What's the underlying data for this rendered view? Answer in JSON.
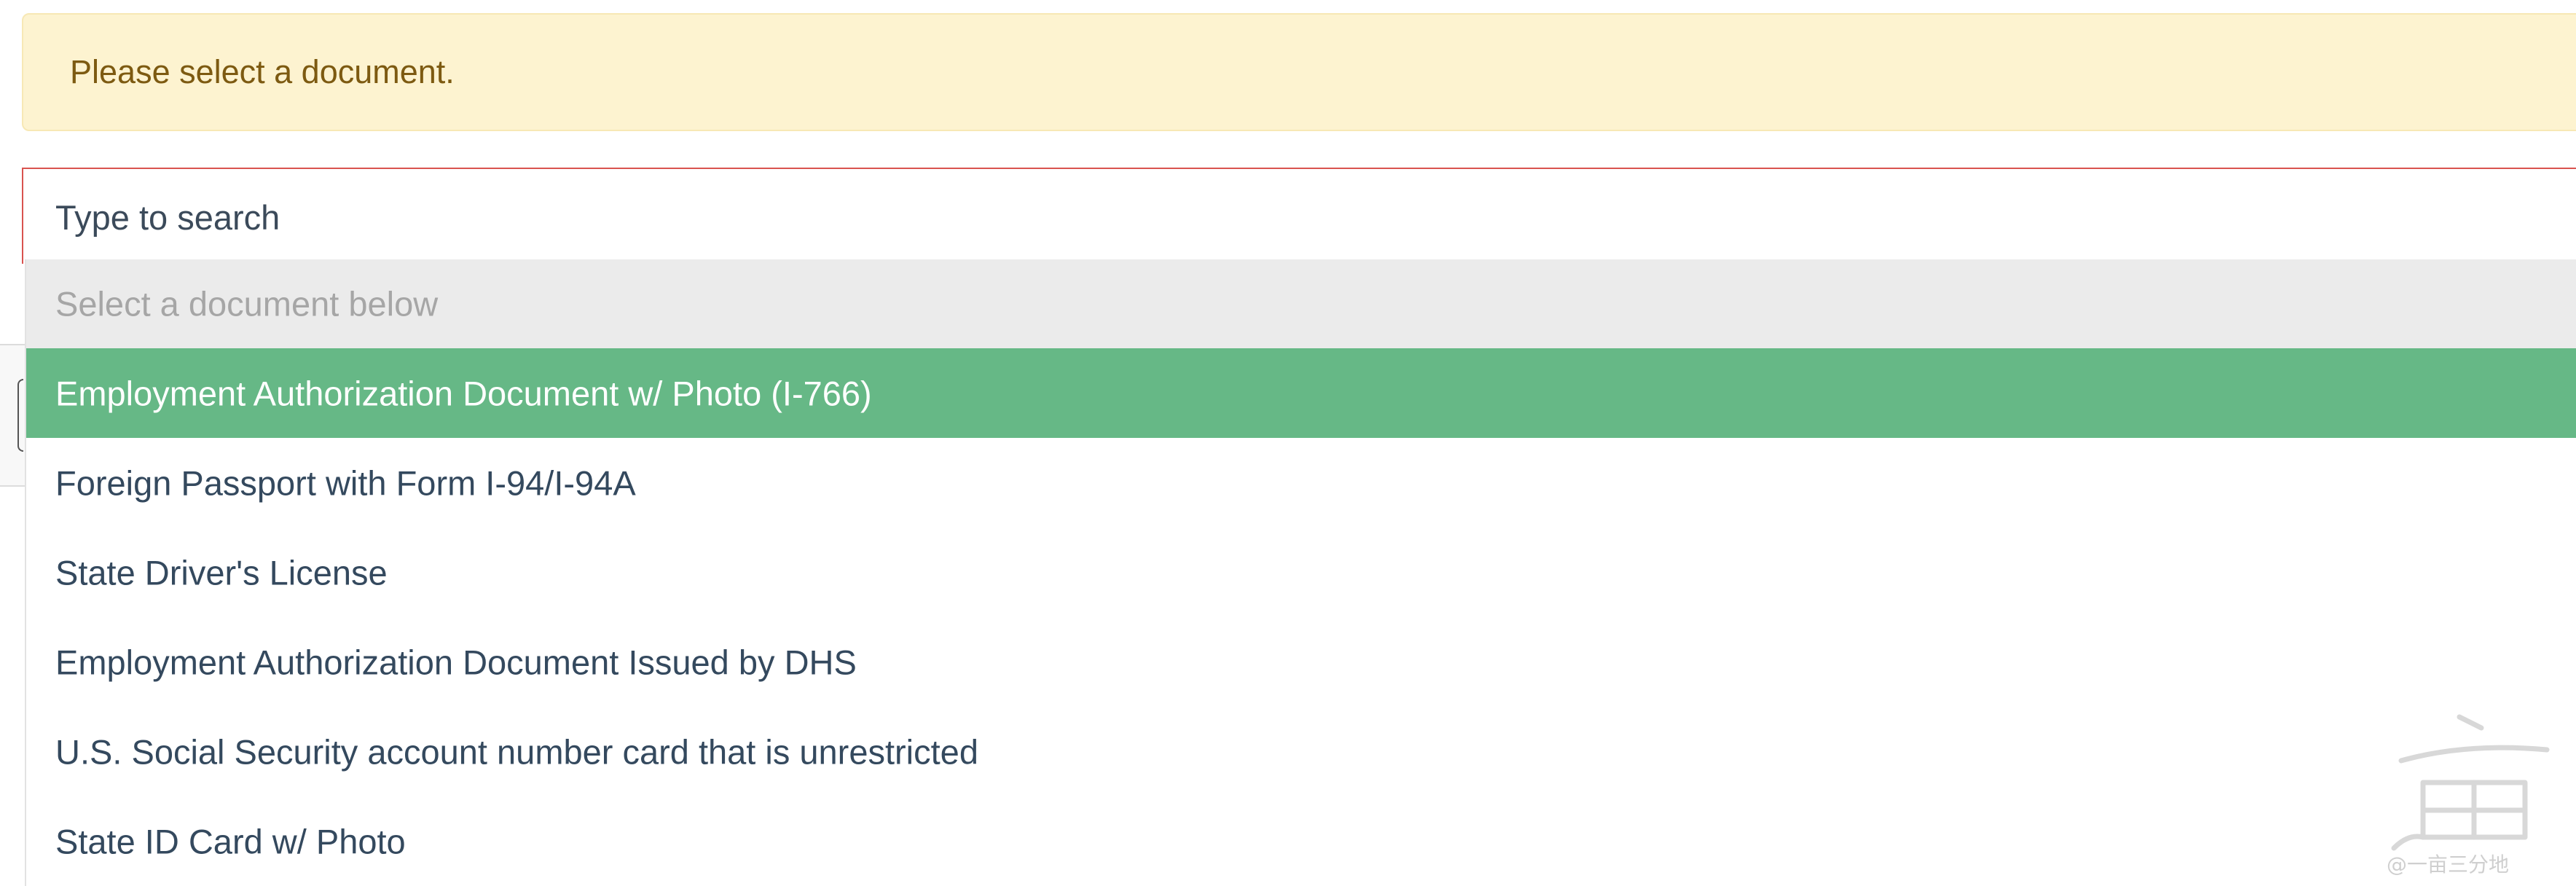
{
  "alert": {
    "message": "Please select a document."
  },
  "search": {
    "placeholder": "Type to search",
    "value": ""
  },
  "dropdown": {
    "header": "Select a document below",
    "options": [
      {
        "label": "Employment Authorization Document w/ Photo (I-766)",
        "highlighted": true
      },
      {
        "label": "Foreign Passport with Form I-94/I-94A",
        "highlighted": false
      },
      {
        "label": "State Driver's License",
        "highlighted": false
      },
      {
        "label": "Employment Authorization Document Issued by DHS",
        "highlighted": false
      },
      {
        "label": "U.S. Social Security account number card that is unrestricted",
        "highlighted": false
      },
      {
        "label": "State ID Card w/ Photo",
        "highlighted": false
      }
    ]
  },
  "colors": {
    "alert_bg": "#fdf3d0",
    "alert_text": "#7d5a11",
    "invalid_border": "#d9534f",
    "highlight": "#66b886",
    "header_bg": "#ebebeb",
    "option_text": "#34495e"
  },
  "watermark": {
    "text": "@一亩三分地"
  }
}
